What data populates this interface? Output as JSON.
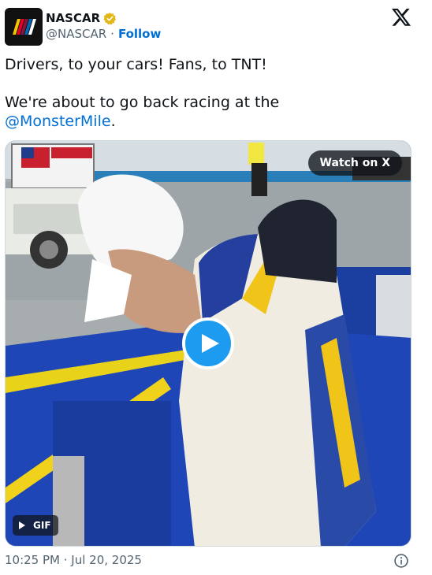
{
  "account": {
    "name": "NASCAR",
    "handle": "@NASCAR",
    "separator": "·",
    "follow_label": "Follow",
    "verified_color": "#e2b719"
  },
  "tweet": {
    "line1": "Drivers, to your cars! Fans, to TNT!",
    "line2_prefix": "We're about to go back racing at the",
    "mention": "@MonsterMile",
    "mention_suffix": "."
  },
  "media": {
    "watch_label": "Watch on X",
    "gif_label": "GIF",
    "play_icon": "play-icon"
  },
  "footer": {
    "timestamp": "10:25 PM · Jul 20, 2025"
  },
  "colors": {
    "link": "#006fd6",
    "play_button": "#1d9bf0",
    "text": "#0f1419",
    "muted": "#536471"
  }
}
